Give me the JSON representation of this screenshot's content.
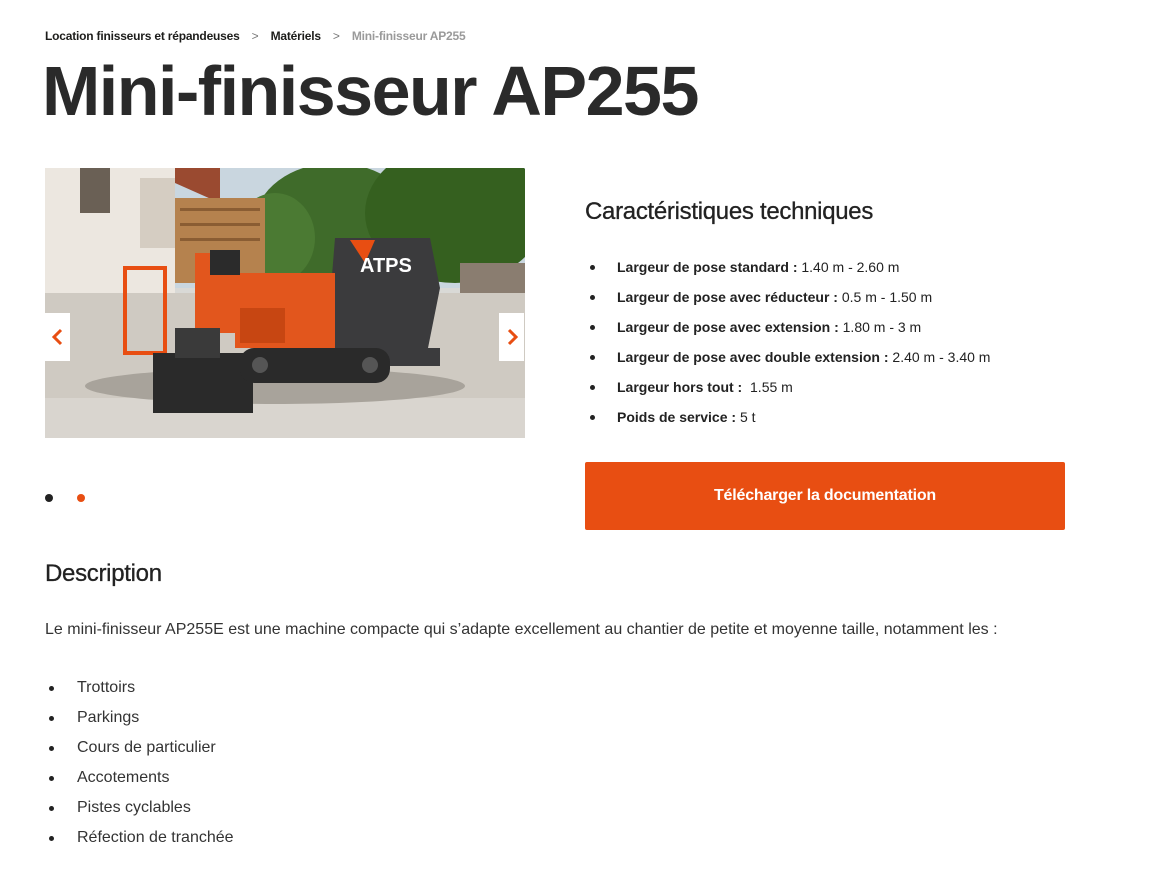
{
  "breadcrumb": {
    "items": [
      "Location finisseurs et répandeuses",
      "Matériels"
    ],
    "separator": ">",
    "current": "Mini-finisseur AP255"
  },
  "page_title": "Mini-finisseur AP255",
  "carousel": {
    "image_text": "ATPS",
    "prev_icon": "chevron-left-icon",
    "next_icon": "chevron-right-icon",
    "slide_count": 2,
    "active_slide": 2
  },
  "specs": {
    "title": "Caractéristiques techniques",
    "items": [
      {
        "label": "Largeur de pose standard :",
        "value": " 1.40 m - 2.60 m"
      },
      {
        "label": "Largeur de pose avec réducteur :",
        "value": " 0.5 m - 1.50 m"
      },
      {
        "label": "Largeur de pose avec extension :",
        "value": " 1.80 m - 3 m"
      },
      {
        "label": "Largeur de pose avec double extension :",
        "value": " 2.40 m - 3.40 m"
      },
      {
        "label": "Largeur hors tout :",
        "value": "  1.55 m"
      },
      {
        "label": "Poids de service :",
        "value": " 5 t"
      }
    ]
  },
  "download_button": "Télécharger la documentation",
  "description": {
    "title": "Description",
    "text": "Le mini-finisseur AP255E est une machine compacte qui s’adapte excellement au chantier de petite et moyenne taille, notamment les :",
    "items": [
      "Trottoirs",
      "Parkings",
      "Cours de particulier",
      "Accotements",
      "Pistes cyclables",
      "Réfection de tranchée"
    ]
  },
  "colors": {
    "accent": "#e84e12",
    "title": "#2a2a2a",
    "breadcrumb_current": "#9a9a9a",
    "dot_inactive": "#222222"
  }
}
